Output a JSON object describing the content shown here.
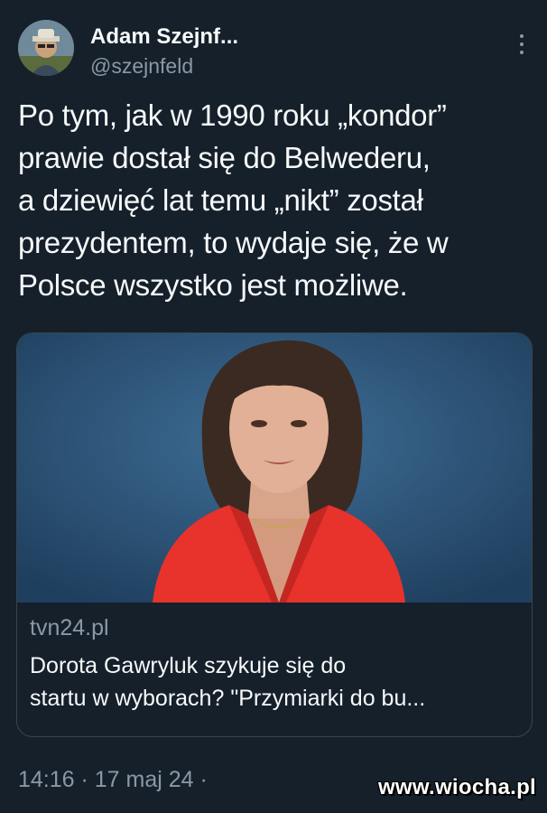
{
  "author": {
    "display_name": "Adam Szejnf...",
    "handle": "@szejnfeld"
  },
  "tweet": {
    "text": "Po tym, jak w 1990 roku „kondor”\nprawie dostał się do Belwederu,\na dziewięć lat temu „nikt” został\nprezydentem, to wydaje się, że w\nPolsce wszystko jest możliwe."
  },
  "link_card": {
    "domain": "tvn24.pl",
    "title": "Dorota Gawryluk szykuje się do\nstartu w wyborach? \"Przymiarki do bu..."
  },
  "meta": {
    "timestamp": "14:16 · 17 maj 24 ·"
  },
  "watermark": "www.wiocha.pl",
  "colors": {
    "background": "#15202b",
    "secondary_text": "#8b98a5",
    "border": "#38444d"
  },
  "icons": {
    "more": "more-vertical-icon"
  }
}
